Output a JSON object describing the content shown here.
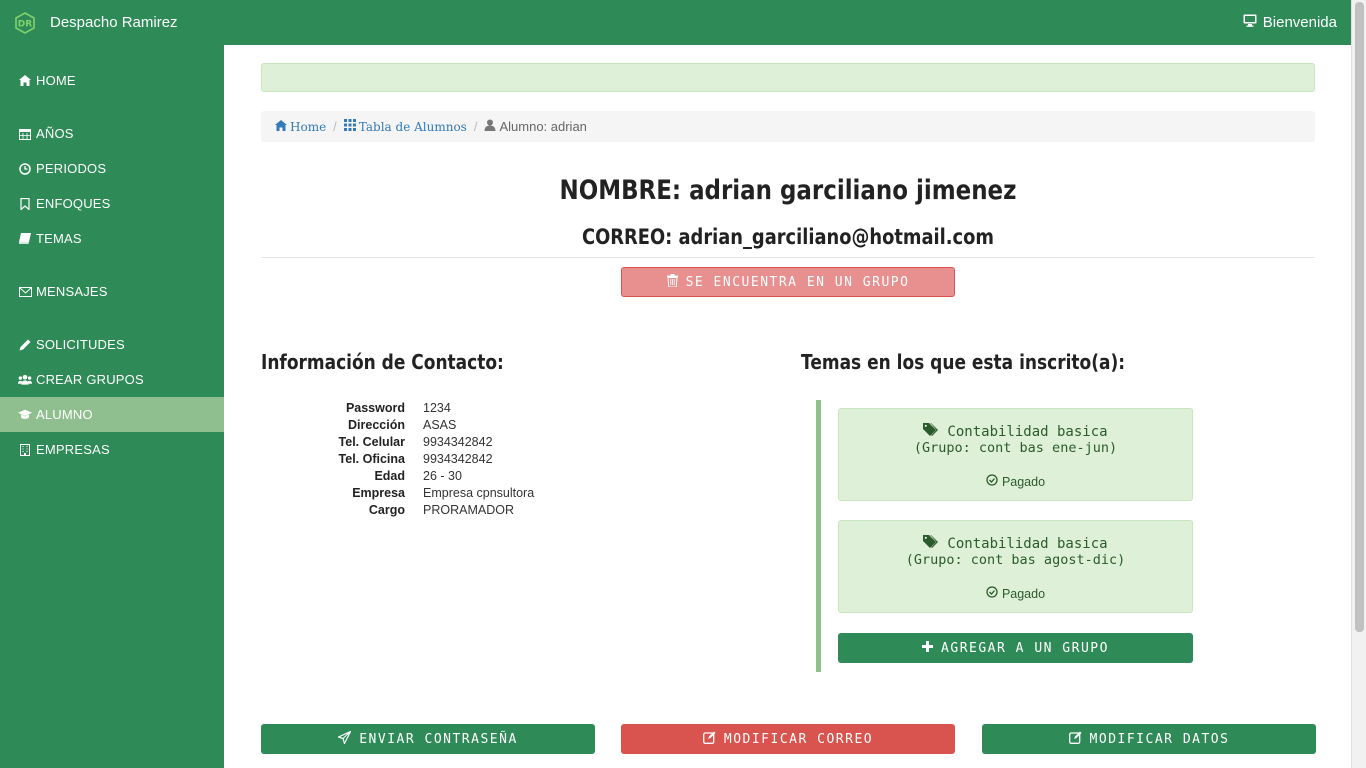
{
  "app": {
    "title": "Despacho Ramirez",
    "welcome": "Bienvenida"
  },
  "colors": {
    "brand": "#2e8b57",
    "active_nav": "#8fbf8f",
    "danger": "#d9534f",
    "success_bg": "#dff0d8"
  },
  "sidebar": {
    "items": [
      {
        "label": "HOME",
        "icon": "home-icon"
      },
      {
        "label": "AÑOS",
        "icon": "calendar-icon"
      },
      {
        "label": "PERIODOS",
        "icon": "clock-icon"
      },
      {
        "label": "ENFOQUES",
        "icon": "bookmark-icon"
      },
      {
        "label": "TEMAS",
        "icon": "book-icon"
      },
      {
        "label": "MENSAJES",
        "icon": "envelope-icon"
      },
      {
        "label": "SOLICITUDES",
        "icon": "pencil-icon"
      },
      {
        "label": "CREAR GRUPOS",
        "icon": "users-icon"
      },
      {
        "label": "ALUMNO",
        "icon": "graduation-cap-icon",
        "active": true
      },
      {
        "label": "EMPRESAS",
        "icon": "building-icon"
      }
    ]
  },
  "breadcrumb": {
    "home": "Home",
    "table": "Tabla de Alumnos",
    "current": "Alumno: adrian"
  },
  "student": {
    "name_line": "NOMBRE: adrian garciliano jimenez",
    "email_line": "CORREO: adrian_garciliano@hotmail.com",
    "group_status_button": "SE ENCUENTRA EN UN GRUPO"
  },
  "contact": {
    "heading": "Información de Contacto:",
    "rows": [
      {
        "label": "Password",
        "value": "1234"
      },
      {
        "label": "Dirección",
        "value": "ASAS"
      },
      {
        "label": "Tel. Celular",
        "value": "9934342842"
      },
      {
        "label": "Tel. Oficina",
        "value": "9934342842"
      },
      {
        "label": "Edad",
        "value": "26 - 30"
      },
      {
        "label": "Empresa",
        "value": "Empresa cpnsultora"
      },
      {
        "label": "Cargo",
        "value": "PRORAMADOR"
      }
    ]
  },
  "temas": {
    "heading": "Temas en los que esta inscrito(a):",
    "items": [
      {
        "title": "Contabilidad basica",
        "group": "(Grupo: cont bas ene-jun)",
        "status": "Pagado"
      },
      {
        "title": "Contabilidad basica",
        "group": "(Grupo: cont bas agost-dic)",
        "status": "Pagado"
      }
    ],
    "add_button": "AGREGAR A UN GRUPO"
  },
  "actions": {
    "send_password": "ENVIAR CONTRASEÑA",
    "modify_email": "MODIFICAR CORREO",
    "modify_data": "MODIFICAR DATOS"
  }
}
